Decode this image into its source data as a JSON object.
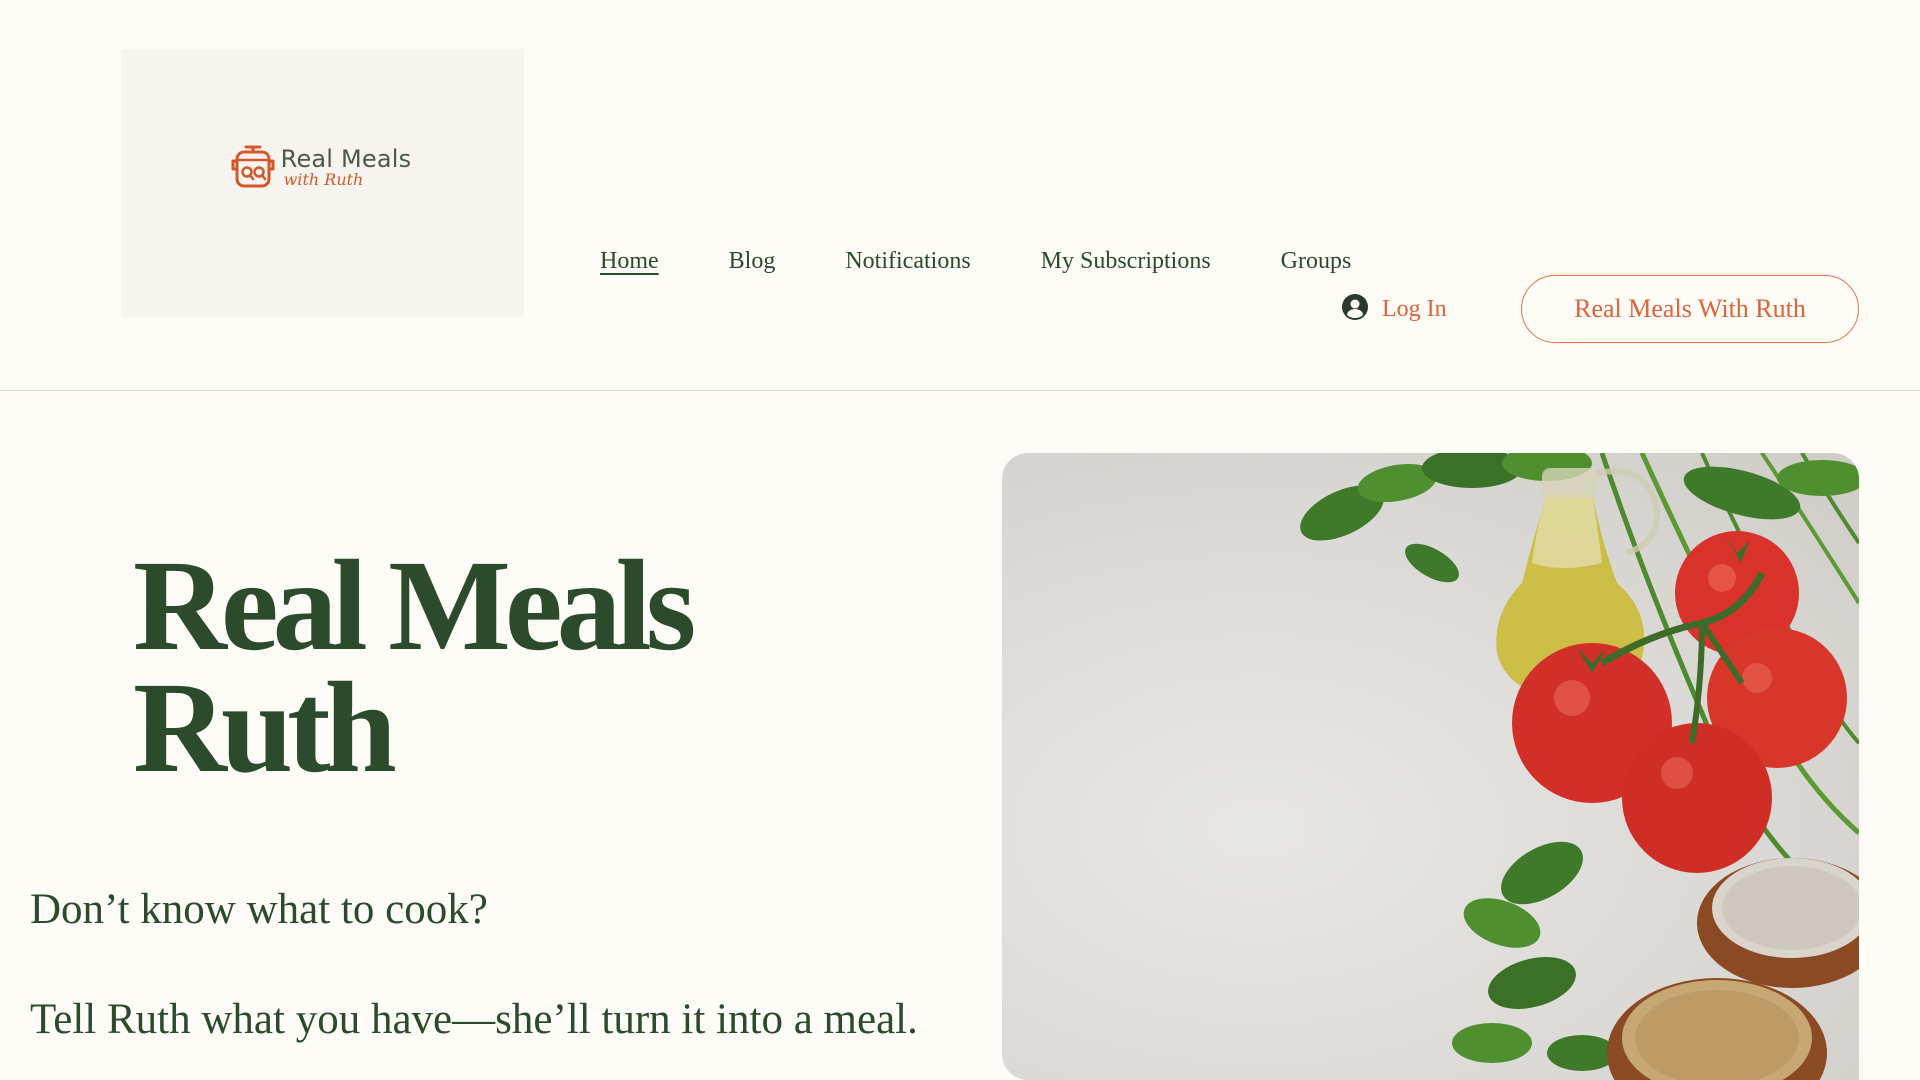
{
  "logo": {
    "title": "Real Meals",
    "subtitle": "with Ruth",
    "brand_color": "#d4582b"
  },
  "nav": {
    "items": [
      {
        "label": "Home",
        "active": true
      },
      {
        "label": "Blog",
        "active": false
      },
      {
        "label": "Notifications",
        "active": false
      },
      {
        "label": "My Subscriptions",
        "active": false
      },
      {
        "label": "Groups",
        "active": false
      }
    ]
  },
  "login": {
    "label": "Log In",
    "icon": "user-avatar-icon"
  },
  "cta": {
    "label": "Real Meals With Ruth"
  },
  "hero": {
    "title_line1": "Real Meals",
    "title_line2": "Ruth",
    "line1": "Don’t know what to cook?",
    "line2": "Tell Ruth what you have—she’ll turn it into a meal."
  },
  "colors": {
    "primary_green": "#2c4a2c",
    "accent_orange": "#e0633a",
    "background": "#fdfcf7"
  }
}
